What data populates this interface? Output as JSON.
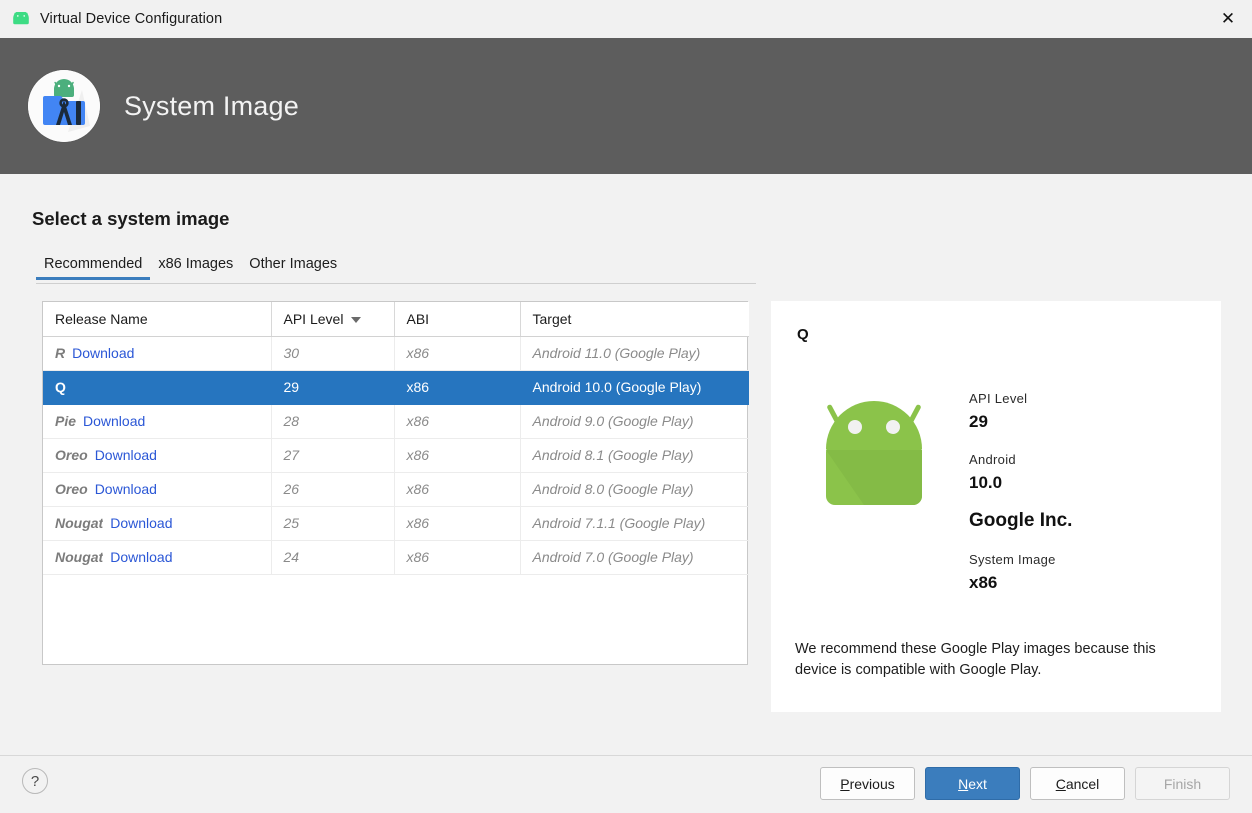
{
  "window": {
    "title": "Virtual Device Configuration",
    "app_icon": "android-robot-icon",
    "close_label": "✕"
  },
  "banner": {
    "title": "System Image",
    "logo_icon": "android-studio-logo-icon"
  },
  "page": {
    "heading": "Select a system image"
  },
  "tabs": [
    {
      "label": "Recommended",
      "active": true
    },
    {
      "label": "x86 Images",
      "active": false
    },
    {
      "label": "Other Images",
      "active": false
    }
  ],
  "table": {
    "columns": [
      {
        "label": "Release Name",
        "sorted": false
      },
      {
        "label": "API Level",
        "sorted": true,
        "sort_icon": "sort-descending-caret-icon"
      },
      {
        "label": "ABI",
        "sorted": false
      },
      {
        "label": "Target",
        "sorted": false
      }
    ],
    "rows": [
      {
        "release": "R",
        "download": "Download",
        "api": "30",
        "abi": "x86",
        "target": "Android 11.0 (Google Play)",
        "selected": false
      },
      {
        "release": "Q",
        "download": "",
        "api": "29",
        "abi": "x86",
        "target": "Android 10.0 (Google Play)",
        "selected": true
      },
      {
        "release": "Pie",
        "download": "Download",
        "api": "28",
        "abi": "x86",
        "target": "Android 9.0 (Google Play)",
        "selected": false
      },
      {
        "release": "Oreo",
        "download": "Download",
        "api": "27",
        "abi": "x86",
        "target": "Android 8.1 (Google Play)",
        "selected": false
      },
      {
        "release": "Oreo",
        "download": "Download",
        "api": "26",
        "abi": "x86",
        "target": "Android 8.0 (Google Play)",
        "selected": false
      },
      {
        "release": "Nougat",
        "download": "Download",
        "api": "25",
        "abi": "x86",
        "target": "Android 7.1.1 (Google Play)",
        "selected": false
      },
      {
        "release": "Nougat",
        "download": "Download",
        "api": "24",
        "abi": "x86",
        "target": "Android 7.0 (Google Play)",
        "selected": false
      }
    ]
  },
  "detail": {
    "title": "Q",
    "robot_icon": "android-mascot-icon",
    "api_level_label": "API Level",
    "api_level_value": "29",
    "android_label": "Android",
    "android_value": "10.0",
    "vendor": "Google Inc.",
    "system_image_label": "System Image",
    "system_image_value": "x86",
    "note": "We recommend these Google Play images because this device is compatible with Google Play."
  },
  "footer": {
    "help_label": "?",
    "previous": {
      "pre": "",
      "mnemonic": "P",
      "post": "revious"
    },
    "next": {
      "pre": "",
      "mnemonic": "N",
      "post": "ext"
    },
    "cancel": {
      "pre": "",
      "mnemonic": "C",
      "post": "ancel"
    },
    "finish": {
      "label": "Finish",
      "disabled": true
    }
  },
  "colors": {
    "selection_blue": "#2675bf",
    "accent_blue": "#3b7dbd",
    "link_blue": "#2b57d6",
    "banner_gray": "#5d5d5d",
    "android_green": "#8bc34a",
    "page_bg": "#f2f2f2"
  }
}
